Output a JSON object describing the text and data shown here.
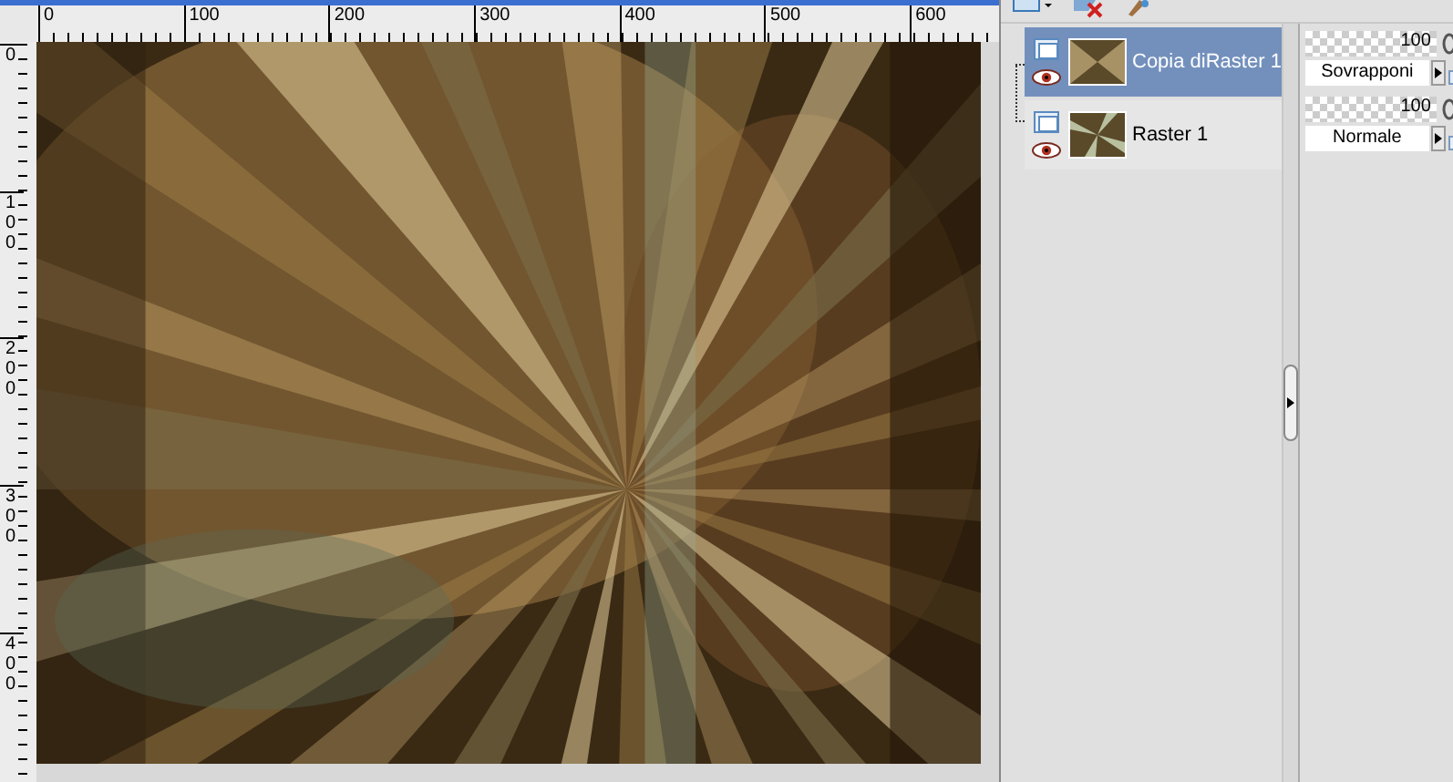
{
  "rulers": {
    "horizontal": [
      "0",
      "100",
      "200",
      "300",
      "400",
      "500",
      "600"
    ],
    "vertical": [
      "0",
      "100",
      "200",
      "300",
      "400"
    ]
  },
  "layers": [
    {
      "name": "Copia diRaster 1",
      "selected": true,
      "visible": true,
      "opacity": "100",
      "blend_mode": "Sovrapponi"
    },
    {
      "name": "Raster 1",
      "selected": false,
      "visible": true,
      "opacity": "100",
      "blend_mode": "Normale"
    }
  ]
}
